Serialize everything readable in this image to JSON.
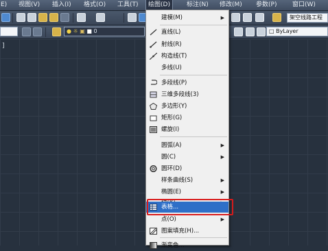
{
  "menubar": {
    "items": [
      "E)",
      "视图(V)",
      "插入(I)",
      "格式(O)",
      "工具(T)",
      "绘图(D)",
      "标注(N)",
      "修改(M)",
      "参数(P)",
      "窗口(W)"
    ]
  },
  "toolbar": {
    "zero_label": "0",
    "text_style_value": "架空线路工程",
    "bylayer_value": "ByLayer"
  },
  "canvas": {
    "viewport_label": "]"
  },
  "draw_menu": {
    "items": [
      {
        "label": "建模(M)",
        "icon": "none",
        "submenu": true
      },
      {
        "label": "直线(L)",
        "icon": "line-icon",
        "submenu": false
      },
      {
        "label": "射线(R)",
        "icon": "ray-icon",
        "submenu": false
      },
      {
        "label": "构造线(T)",
        "icon": "construction-line-icon",
        "submenu": false
      },
      {
        "label": "多线(U)",
        "icon": "none",
        "submenu": false
      },
      {
        "label": "多段线(P)",
        "icon": "polyline-icon",
        "submenu": false
      },
      {
        "label": "三维多段线(3)",
        "icon": "3d-polyline-icon",
        "submenu": false
      },
      {
        "label": "多边形(Y)",
        "icon": "polygon-icon",
        "submenu": false
      },
      {
        "label": "矩形(G)",
        "icon": "rectangle-icon",
        "submenu": false
      },
      {
        "label": "螺旋(I)",
        "icon": "helix-icon",
        "submenu": false
      },
      {
        "label": "圆弧(A)",
        "icon": "none",
        "submenu": true
      },
      {
        "label": "圆(C)",
        "icon": "none",
        "submenu": true
      },
      {
        "label": "圆环(D)",
        "icon": "donut-icon",
        "submenu": false
      },
      {
        "label": "样条曲线(S)",
        "icon": "none",
        "submenu": true
      },
      {
        "label": "椭圆(E)",
        "icon": "none",
        "submenu": true
      },
      {
        "label": "块(K)",
        "icon": "none",
        "submenu": true
      },
      {
        "label": "表格...",
        "icon": "table-icon",
        "submenu": false,
        "highlighted": true
      },
      {
        "label": "点(O)",
        "icon": "none",
        "submenu": true
      },
      {
        "label": "图案填充(H)...",
        "icon": "hatch-icon",
        "submenu": false
      },
      {
        "label": "渐变色...",
        "icon": "gradient-icon",
        "submenu": false
      }
    ]
  },
  "colors": {
    "highlight": "#2f6fc7",
    "annotation_box": "#d81b1b",
    "canvas_bg": "#27313e"
  }
}
